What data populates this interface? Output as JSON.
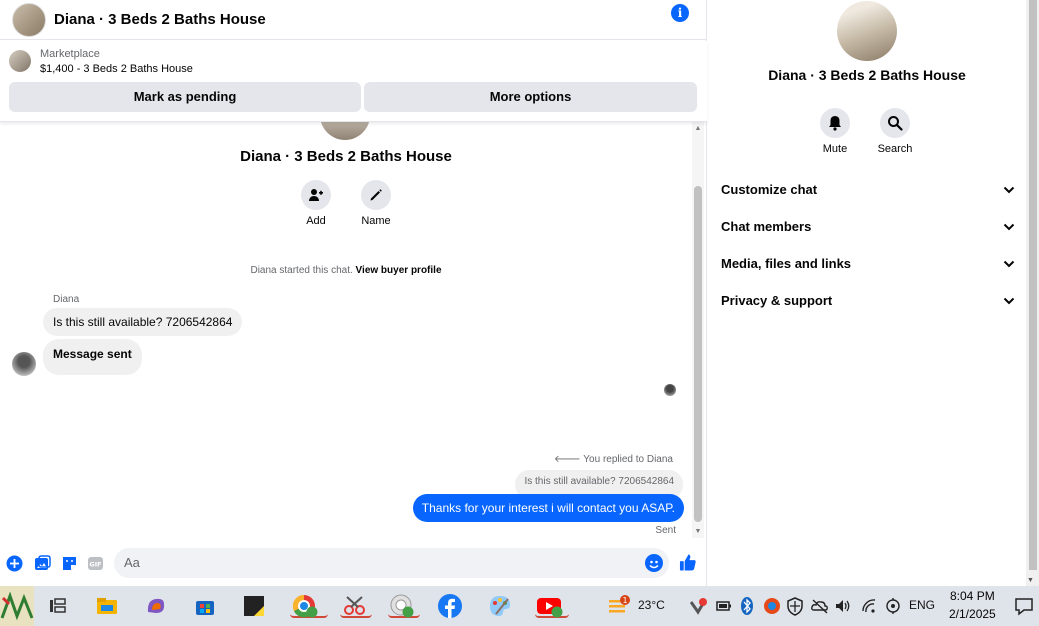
{
  "header": {
    "title": "Diana · 3 Beds 2 Baths House",
    "info_icon": "i"
  },
  "marketplace": {
    "label": "Marketplace",
    "listing": "$1,400 - 3 Beds 2 Baths House",
    "mark_pending": "Mark as pending",
    "more_options": "More options"
  },
  "conversation": {
    "name": "Diana · 3 Beds 2 Baths House",
    "add_label": "Add",
    "name_label": "Name",
    "started_prefix": "Diana started this chat.",
    "view_buyer_profile": "View buyer profile",
    "sender": "Diana",
    "msg1": "Is this still available? 7206542864",
    "msg2": "Message sent",
    "replied_note": "You replied to Diana",
    "quoted": "Is this still available? 7206542864",
    "reply": "Thanks for your interest i will contact you ASAP.",
    "sent_label": "Sent"
  },
  "composer": {
    "placeholder": "Aa"
  },
  "details": {
    "name": "Diana · 3 Beds 2 Baths House",
    "mute": "Mute",
    "search": "Search",
    "sections": [
      "Customize chat",
      "Chat members",
      "Media, files and links",
      "Privacy & support"
    ]
  },
  "taskbar": {
    "weather": "23°C",
    "weather_badge": "1",
    "lang": "ENG",
    "time": "8:04 PM",
    "date": "2/1/2025"
  },
  "colors": {
    "accent": "#0866ff",
    "bubble_in": "#f0f0f0",
    "button_bg": "#e4e6eb"
  }
}
